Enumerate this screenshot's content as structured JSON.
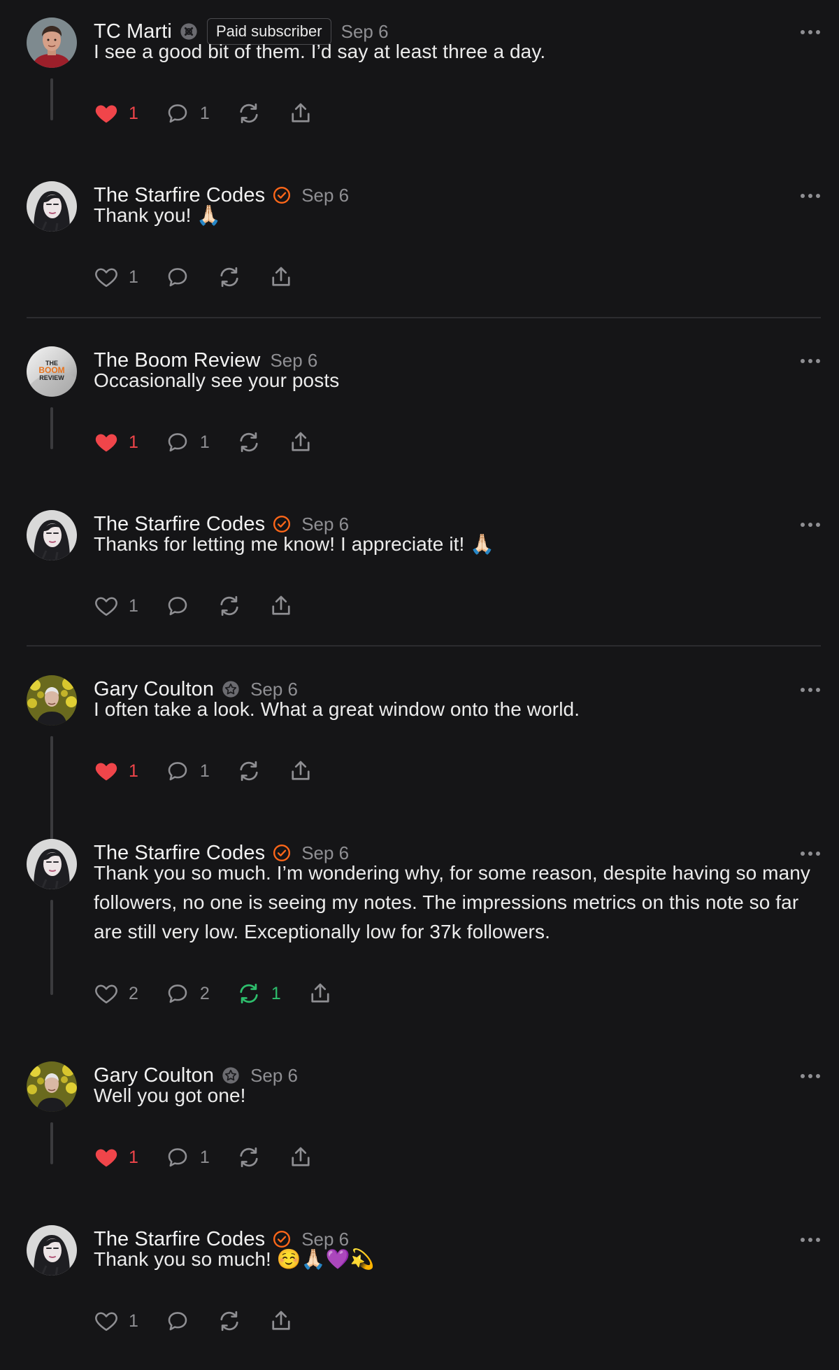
{
  "notes": [
    {
      "author": "TC Marti",
      "badge": "subscriber-badge-icon",
      "pill": "Paid subscriber",
      "date": "Sep 6",
      "text": "I see a good bit of them. I’d say at least three a day.",
      "likes": "1",
      "liked": true,
      "comments": "1",
      "restacks": "",
      "restacked": false,
      "avatar": "man-red-shirt"
    },
    {
      "author": "The Starfire Codes",
      "badge": "verified-check-icon",
      "pill": "",
      "date": "Sep 6",
      "text": "Thank you! 🙏🏻",
      "likes": "1",
      "liked": false,
      "comments": "",
      "restacks": "",
      "restacked": false,
      "avatar": "woman-dark-hair"
    },
    {
      "author": "The Boom Review",
      "badge": "",
      "pill": "",
      "date": "Sep 6",
      "text": "Occasionally see your posts",
      "likes": "1",
      "liked": true,
      "comments": "1",
      "restacks": "",
      "restacked": false,
      "avatar": "boom-review-logo",
      "logo_text": [
        "THE",
        "BOOM",
        "REVIEW"
      ]
    },
    {
      "author": "The Starfire Codes",
      "badge": "verified-check-icon",
      "pill": "",
      "date": "Sep 6",
      "text": "Thanks for letting me know! I appreciate it! 🙏🏻",
      "likes": "1",
      "liked": false,
      "comments": "",
      "restacks": "",
      "restacked": false,
      "avatar": "woman-dark-hair"
    },
    {
      "author": "Gary Coulton",
      "badge": "subscriber-star-icon",
      "pill": "",
      "date": "Sep 6",
      "text": "I often take a look. What a great window onto the world.",
      "likes": "1",
      "liked": true,
      "comments": "1",
      "restacks": "",
      "restacked": false,
      "avatar": "man-yellow-flowers"
    },
    {
      "author": "The Starfire Codes",
      "badge": "verified-check-icon",
      "pill": "",
      "date": "Sep 6",
      "text": "Thank you so much. I’m wondering why, for some reason, despite having so many followers, no one is seeing my notes. The impressions metrics on this note so far are still very low. Exceptionally low for 37k followers.",
      "likes": "2",
      "liked": false,
      "comments": "2",
      "restacks": "1",
      "restacked": true,
      "avatar": "woman-dark-hair"
    },
    {
      "author": "Gary Coulton",
      "badge": "subscriber-star-icon",
      "pill": "",
      "date": "Sep 6",
      "text": "Well you got one!",
      "likes": "1",
      "liked": true,
      "comments": "1",
      "restacks": "",
      "restacked": false,
      "avatar": "man-yellow-flowers"
    },
    {
      "author": "The Starfire Codes",
      "badge": "verified-check-icon",
      "pill": "",
      "date": "Sep 6",
      "text": "Thank you so much! ☺️🙏🏻💜💫",
      "likes": "1",
      "liked": false,
      "comments": "",
      "restacks": "",
      "restacked": false,
      "avatar": "woman-dark-hair"
    }
  ],
  "colors": {
    "background": "#151517",
    "like_red": "#f0454a",
    "restack_green": "#2ebf6d",
    "verified_orange": "#ff6719",
    "muted_text": "#8f8f93"
  }
}
